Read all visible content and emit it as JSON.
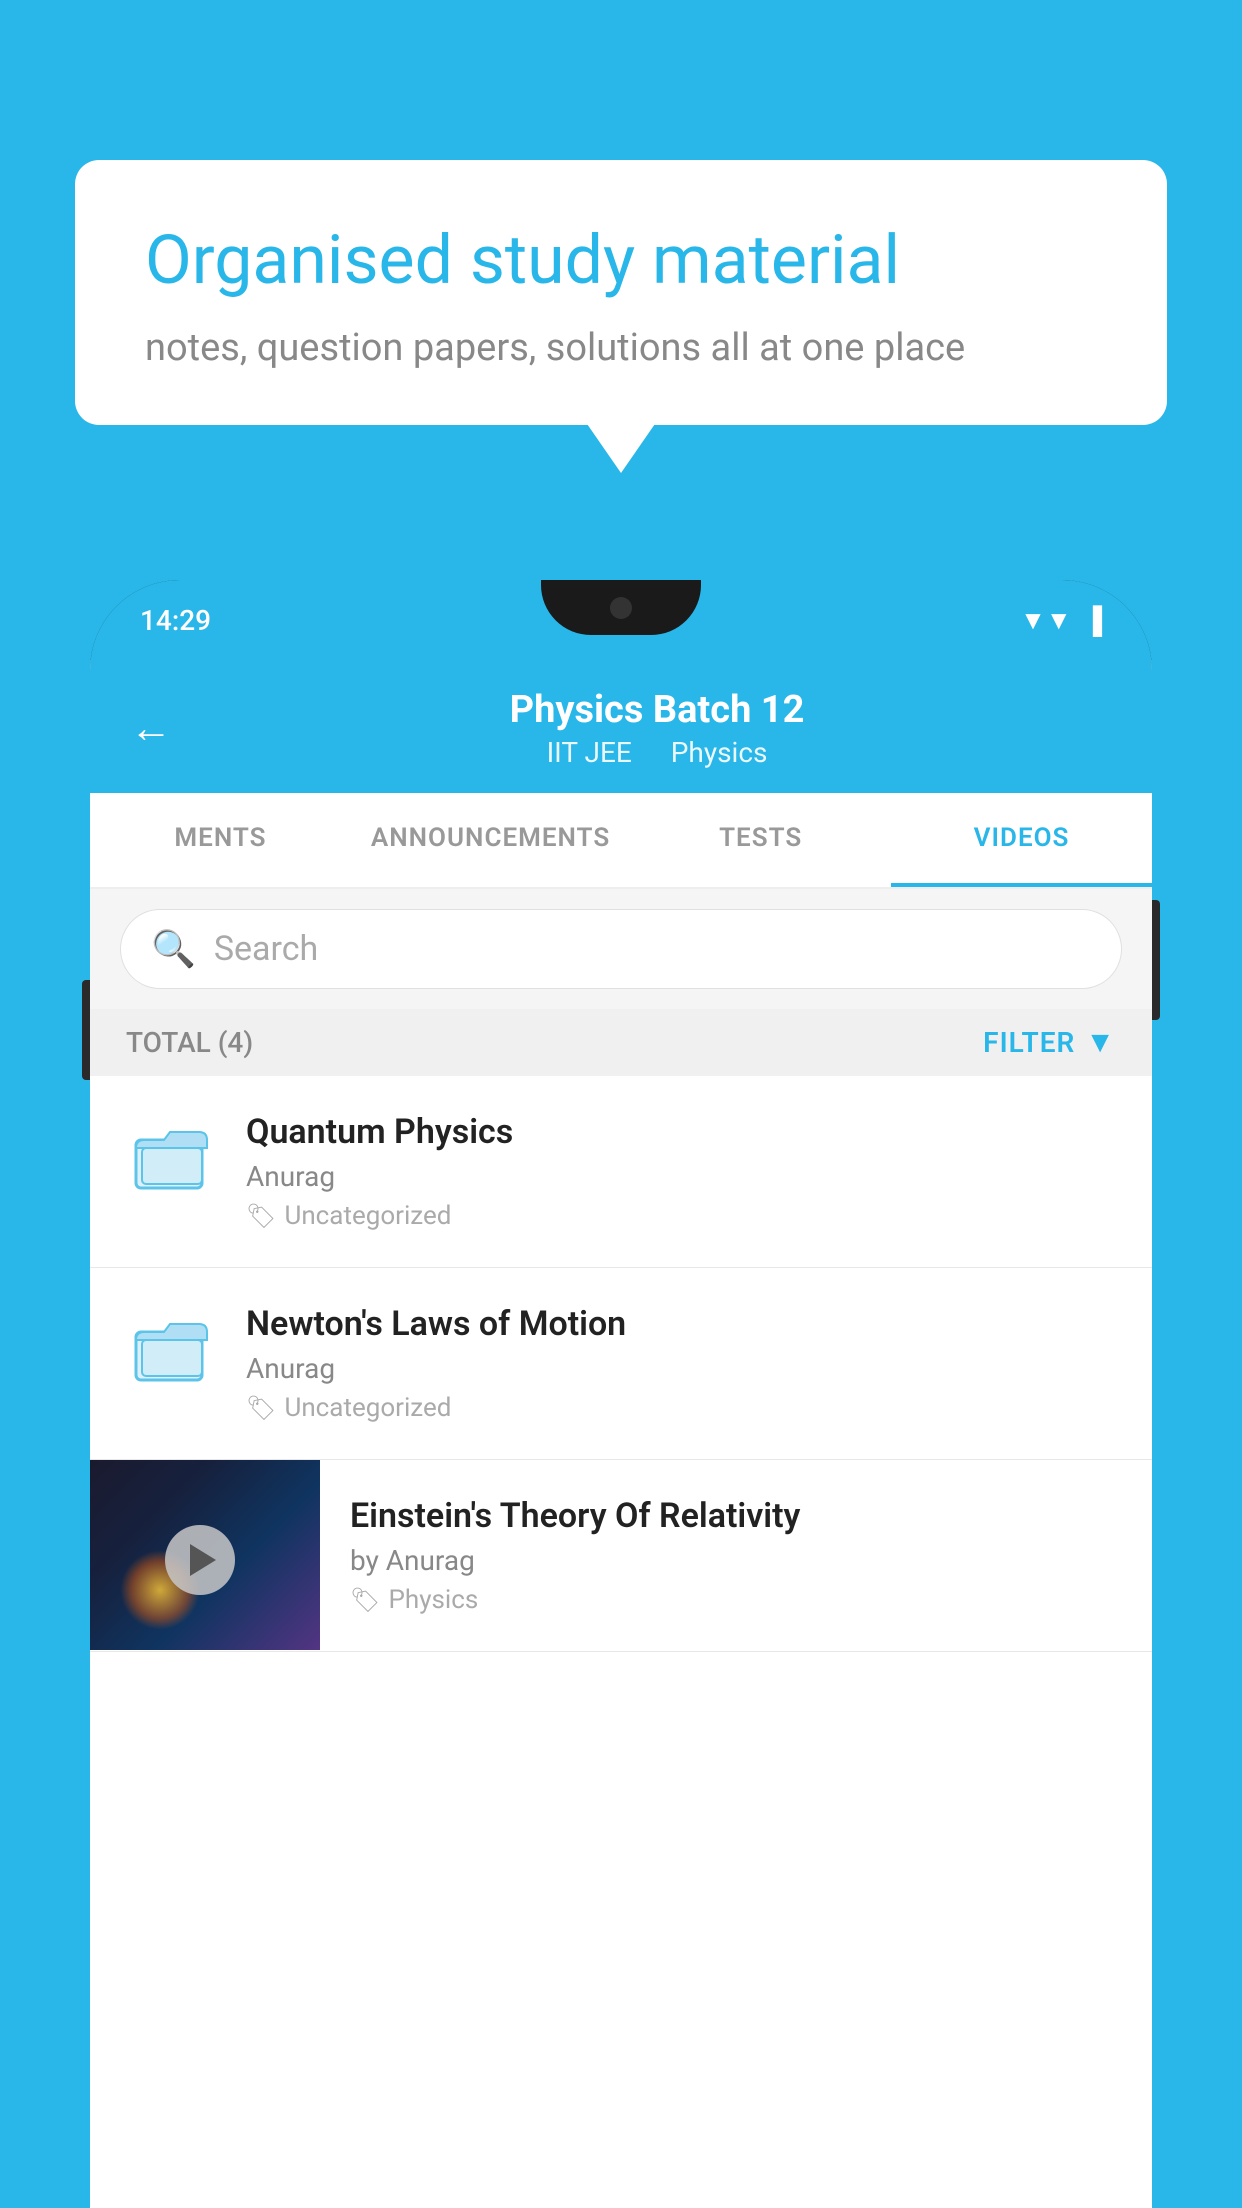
{
  "background_color": "#29b6e8",
  "speech_bubble": {
    "title": "Organised study material",
    "subtitle": "notes, question papers, solutions all at one place"
  },
  "phone": {
    "status_bar": {
      "time": "14:29"
    },
    "header": {
      "title": "Physics Batch 12",
      "subtitle_part1": "IIT JEE",
      "subtitle_part2": "Physics",
      "back_label": "←"
    },
    "tabs": [
      {
        "label": "MENTS",
        "active": false
      },
      {
        "label": "ANNOUNCEMENTS",
        "active": false
      },
      {
        "label": "TESTS",
        "active": false
      },
      {
        "label": "VIDEOS",
        "active": true
      }
    ],
    "search": {
      "placeholder": "Search"
    },
    "filter_row": {
      "total_label": "TOTAL (4)",
      "filter_label": "FILTER"
    },
    "videos": [
      {
        "title": "Quantum Physics",
        "author": "Anurag",
        "tag": "Uncategorized",
        "has_thumbnail": false
      },
      {
        "title": "Newton's Laws of Motion",
        "author": "Anurag",
        "tag": "Uncategorized",
        "has_thumbnail": false
      },
      {
        "title": "Einstein's Theory Of Relativity",
        "author": "by Anurag",
        "tag": "Physics",
        "has_thumbnail": true
      }
    ]
  }
}
